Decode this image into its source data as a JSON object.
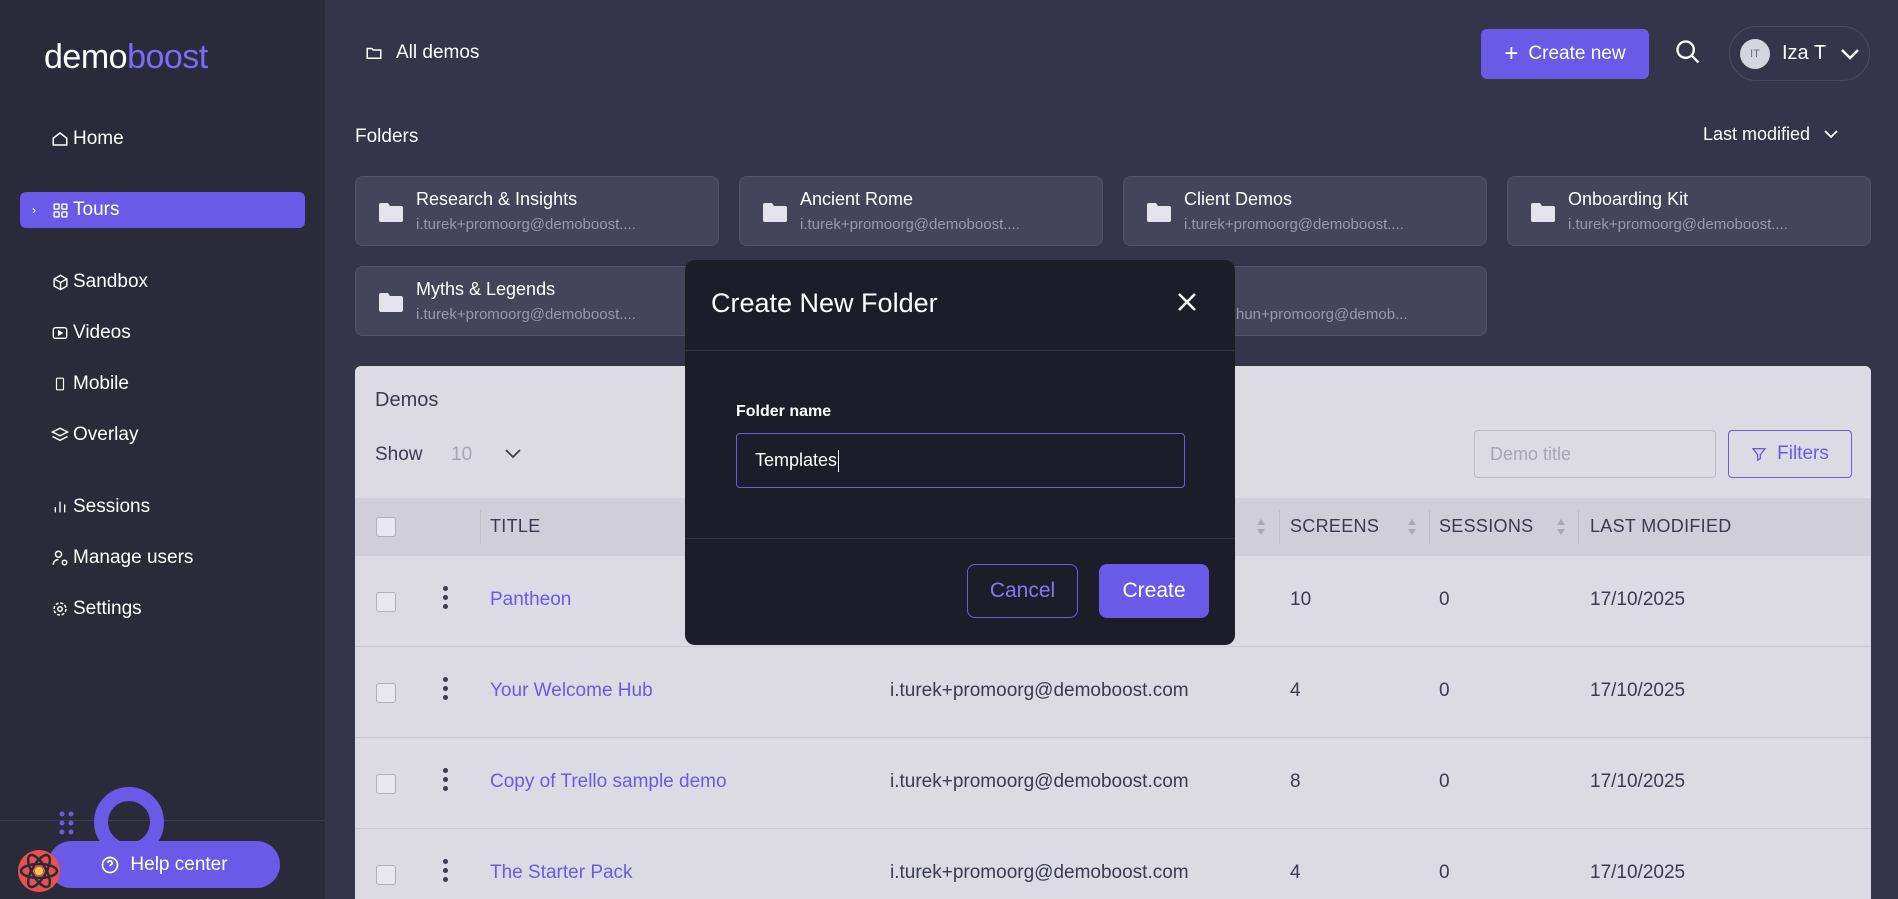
{
  "brand": {
    "logo_part1": "demo",
    "logo_part2": "boost"
  },
  "sidebar": {
    "items": [
      {
        "label": "Home",
        "icon": "home-icon"
      },
      {
        "label": "Tours",
        "icon": "grid-icon",
        "active": true
      },
      {
        "label": "Sandbox",
        "icon": "cube-icon"
      },
      {
        "label": "Videos",
        "icon": "video-icon"
      },
      {
        "label": "Mobile",
        "icon": "mobile-icon"
      },
      {
        "label": "Overlay",
        "icon": "layers-icon"
      },
      {
        "label": "Sessions",
        "icon": "bar-chart-icon"
      },
      {
        "label": "Manage users",
        "icon": "user-gear-icon"
      },
      {
        "label": "Settings",
        "icon": "gear-icon"
      }
    ],
    "help_label": "Help center"
  },
  "header": {
    "breadcrumb": "All demos",
    "create_new_label": "Create new",
    "user_initials": "IT",
    "user_name": "Iza T"
  },
  "folders": {
    "section_label": "Folders",
    "sort_label": "Last modified",
    "items": [
      {
        "name": "Research & Insights",
        "owner": "i.turek+promoorg@demoboost...."
      },
      {
        "name": "Ancient Rome",
        "owner": "i.turek+promoorg@demoboost...."
      },
      {
        "name": "Client Demos",
        "owner": "i.turek+promoorg@demoboost...."
      },
      {
        "name": "Onboarding Kit",
        "owner": "i.turek+promoorg@demoboost...."
      },
      {
        "name": "Myths & Legends",
        "owner": "i.turek+promoorg@demoboost...."
      },
      {
        "name": "",
        "owner": "hun+promoorg@demob..."
      }
    ]
  },
  "demos": {
    "title": "Demos",
    "show_label": "Show",
    "show_value": "10",
    "search_placeholder": "Demo title",
    "filters_label": "Filters",
    "columns": {
      "title": "TITLE",
      "screens": "SCREENS",
      "sessions": "SESSIONS",
      "last_modified": "LAST MODIFIED"
    },
    "rows": [
      {
        "title": "Pantheon",
        "owner": "",
        "screens": "10",
        "sessions": "0",
        "last_modified": "17/10/2025"
      },
      {
        "title": "Your Welcome Hub",
        "owner": "i.turek+promoorg@demoboost.com",
        "screens": "4",
        "sessions": "0",
        "last_modified": "17/10/2025"
      },
      {
        "title": "Copy of Trello sample demo",
        "owner": "i.turek+promoorg@demoboost.com",
        "screens": "8",
        "sessions": "0",
        "last_modified": "17/10/2025"
      },
      {
        "title": "The Starter Pack",
        "owner": "i.turek+promoorg@demoboost.com",
        "screens": "4",
        "sessions": "0",
        "last_modified": "17/10/2025"
      }
    ]
  },
  "modal": {
    "title": "Create New Folder",
    "field_label": "Folder name",
    "field_value": "Templates",
    "cancel_label": "Cancel",
    "create_label": "Create"
  },
  "colors": {
    "accent": "#6b5ae8",
    "sidebar": "#2a2a3a",
    "background": "#34344a",
    "modal": "#1d1d29"
  }
}
